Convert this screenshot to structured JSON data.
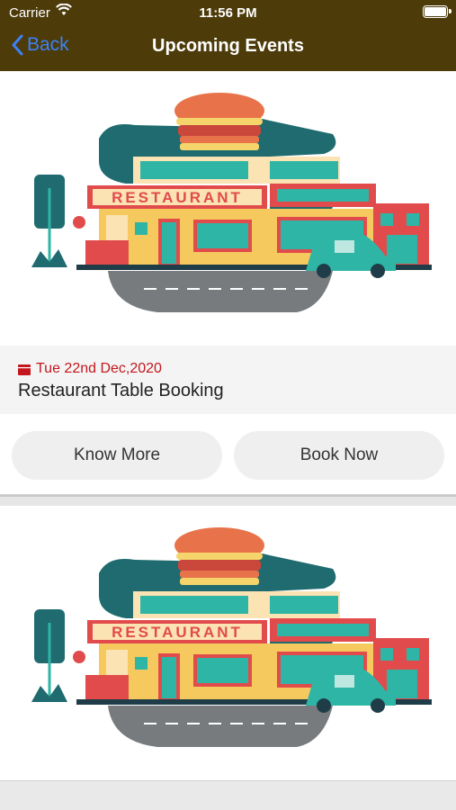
{
  "status_bar": {
    "carrier": "Carrier",
    "time": "11:56 PM"
  },
  "nav": {
    "back_label": "Back",
    "title": "Upcoming Events"
  },
  "colors": {
    "header": "#4d3b0a",
    "back_link": "#3b82f6",
    "date": "#c3171d"
  },
  "events": [
    {
      "image_sign": "RESTAURANT",
      "date": "Tue 22nd Dec,2020",
      "title": "Restaurant Table Booking",
      "know_more_label": "Know More",
      "book_now_label": "Book Now"
    },
    {
      "image_sign": "RESTAURANT"
    }
  ]
}
